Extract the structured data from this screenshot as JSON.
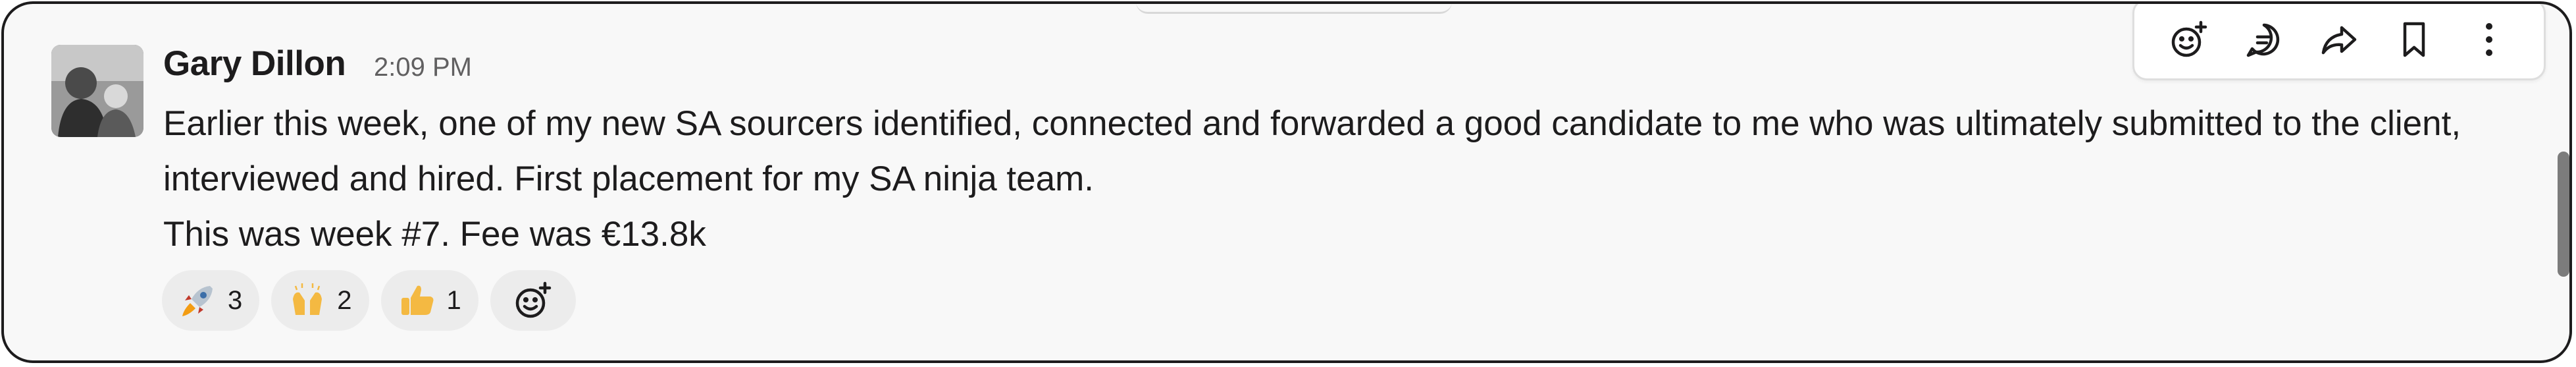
{
  "message": {
    "sender": "Gary Dillon",
    "time": "2:09 PM",
    "lines": [
      "Earlier this week, one of my new SA sourcers identified, connected and forwarded a good candidate to me who was ultimately submitted to the client, interviewed and hired. First placement for my SA ninja team.",
      "This was week #7. Fee was €13.8k"
    ]
  },
  "reactions": [
    {
      "icon": "rocket-emoji",
      "count": "3"
    },
    {
      "icon": "raised-hands-emoji",
      "count": "2"
    },
    {
      "icon": "thumbs-up-emoji",
      "count": "1"
    }
  ],
  "toolbar": {
    "icons": [
      "add-reaction-icon",
      "reply-in-thread-icon",
      "share-icon",
      "bookmark-icon",
      "more-actions-icon"
    ]
  },
  "colors": {
    "background": "#f8f8f8",
    "text": "#1d1c1d",
    "muted": "#616061",
    "pill": "#ececec"
  }
}
